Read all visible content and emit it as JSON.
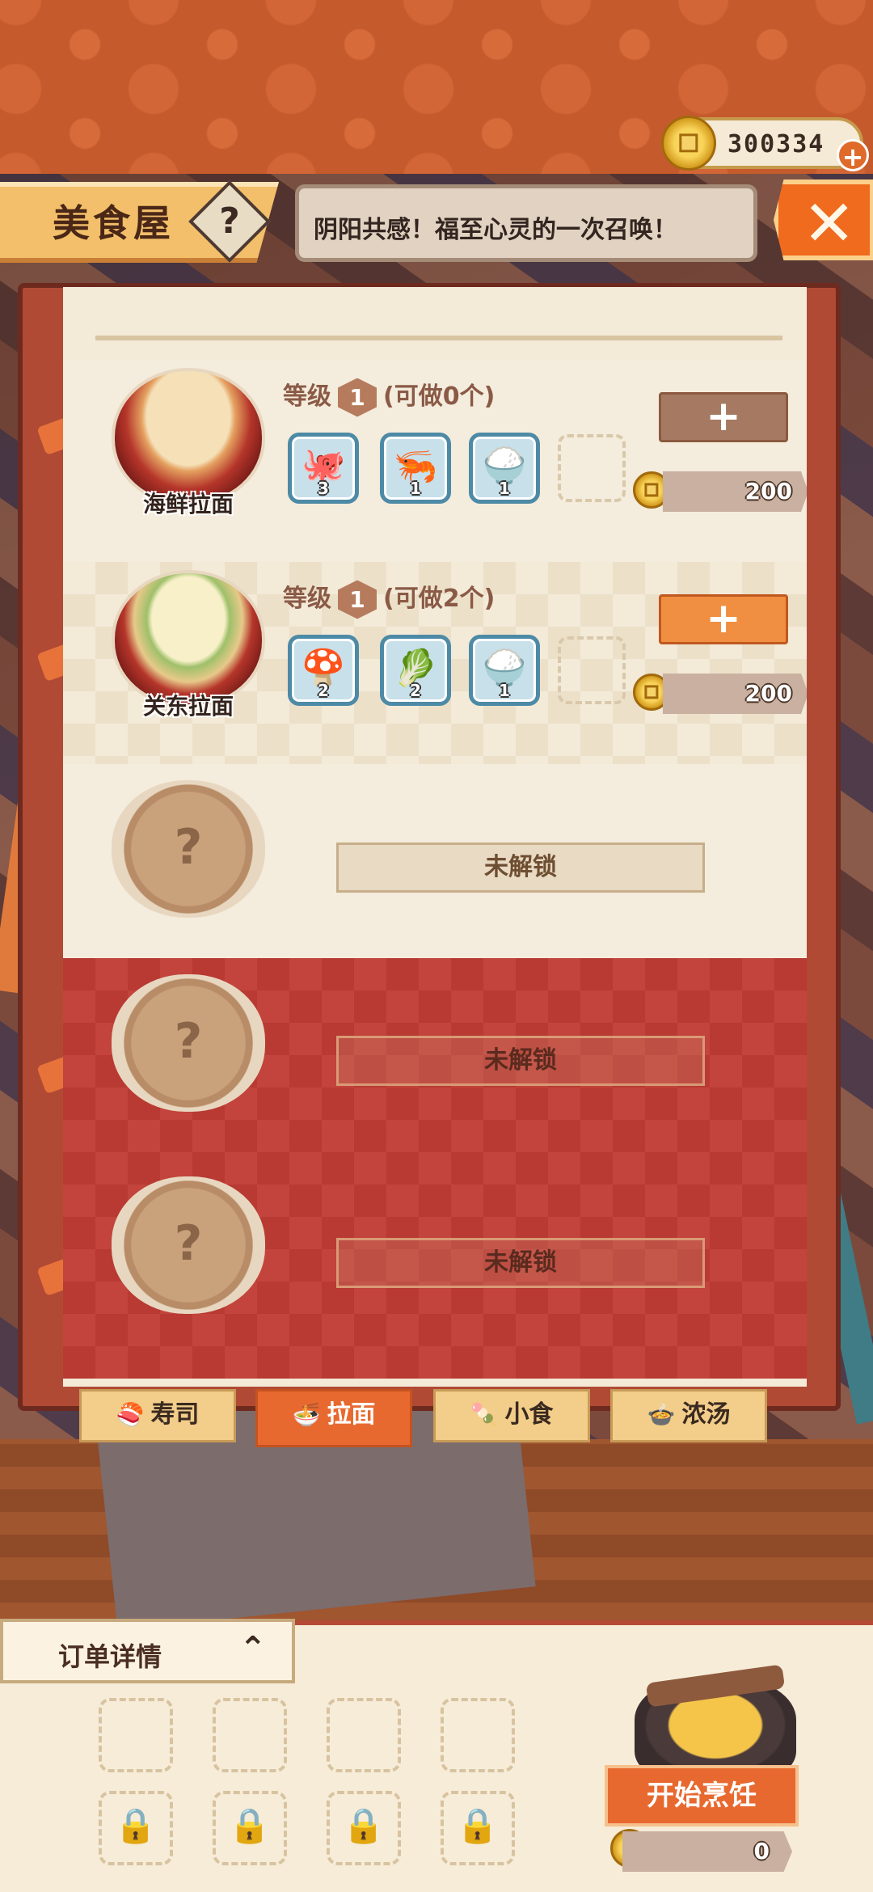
{
  "currency": {
    "coins": "300334",
    "add_label": "+"
  },
  "header": {
    "title": "美食屋",
    "help_label": "?",
    "banner_text": "阴阳共感！福至心灵的一次召唤！",
    "close_label": "✕"
  },
  "recipes": [
    {
      "name": "海鲜拉面",
      "level_label": "等级",
      "level": "1",
      "can_make": "(可做0个)",
      "ingredients": [
        {
          "icon": "octopus-icon",
          "glyph": "🐙",
          "count": "3"
        },
        {
          "icon": "shrimp-icon",
          "glyph": "🦐",
          "count": "1"
        },
        {
          "icon": "rice-sack-icon",
          "glyph": "🍚",
          "count": "1"
        }
      ],
      "add_label": "+",
      "add_enabled": false,
      "price": "200"
    },
    {
      "name": "关东拉面",
      "level_label": "等级",
      "level": "1",
      "can_make": "(可做2个)",
      "ingredients": [
        {
          "icon": "mushroom-icon",
          "glyph": "🍄",
          "count": "2"
        },
        {
          "icon": "radish-icon",
          "glyph": "🥬",
          "count": "2"
        },
        {
          "icon": "rice-sack-icon",
          "glyph": "🍚",
          "count": "1"
        }
      ],
      "add_label": "+",
      "add_enabled": true,
      "price": "200"
    }
  ],
  "locked_slots": [
    {
      "label": "未解锁",
      "placeholder": "?"
    },
    {
      "label": "未解锁",
      "placeholder": "?"
    },
    {
      "label": "未解锁",
      "placeholder": "?"
    }
  ],
  "tabs": [
    {
      "label": "寿司",
      "icon": "sushi-icon",
      "glyph": "🍣",
      "active": false
    },
    {
      "label": "拉面",
      "icon": "ramen-icon",
      "glyph": "🍜",
      "active": true
    },
    {
      "label": "小食",
      "icon": "snack-icon",
      "glyph": "🍡",
      "active": false
    },
    {
      "label": "浓汤",
      "icon": "soup-icon",
      "glyph": "🍲",
      "active": false
    }
  ],
  "order": {
    "title": "订单详情",
    "toggle_glyph": "⌃",
    "lock_glyph": "🔒"
  },
  "cooking": {
    "start_label": "开始烹饪",
    "cost": "0"
  },
  "colors": {
    "accent": "#e8692f",
    "panel": "#f3ead8",
    "red_zone": "#c2443c"
  }
}
